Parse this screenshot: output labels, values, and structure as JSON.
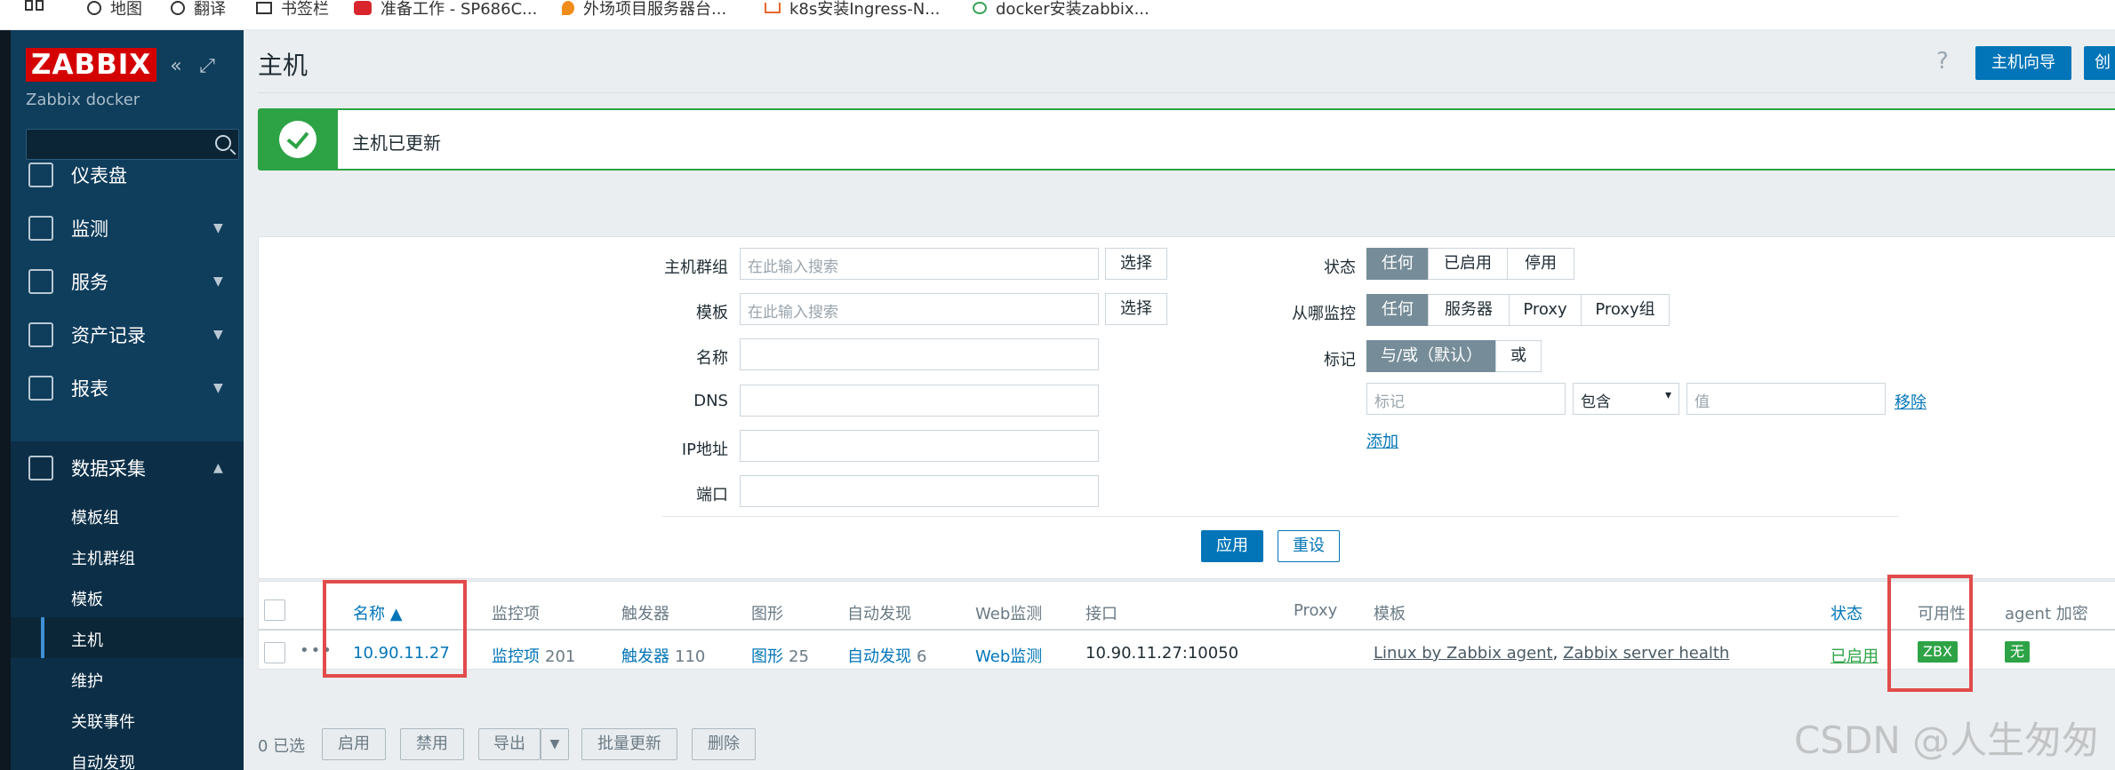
{
  "bookmarks": [
    "地图",
    "翻译",
    "书签栏",
    "准备工作 - SP686C...",
    "外场项目服务器台...",
    "k8s安装Ingress-N...",
    "docker安装zabbix..."
  ],
  "sidebar": {
    "logo": "ZABBIX",
    "subtitle": "Zabbix docker",
    "search_placeholder": "",
    "items": [
      {
        "label": "仪表盘",
        "icon": "dashboard-icon"
      },
      {
        "label": "监测",
        "icon": "monitoring-icon"
      },
      {
        "label": "服务",
        "icon": "services-icon"
      },
      {
        "label": "资产记录",
        "icon": "inventory-icon"
      },
      {
        "label": "报表",
        "icon": "reports-icon"
      },
      {
        "label": "数据采集",
        "icon": "data-collection-icon"
      }
    ],
    "subitems": [
      "模板组",
      "主机群组",
      "模板",
      "主机",
      "维护",
      "关联事件",
      "自动发现"
    ]
  },
  "header": {
    "title": "主机",
    "help": "?",
    "create_wizard": "主机向导",
    "create_host": "创"
  },
  "message": {
    "text": "主机已更新",
    "color": "#2da346"
  },
  "filter": {
    "host_groups_label": "主机群组",
    "host_groups_placeholder": "在此输入搜索",
    "templates_label": "模板",
    "templates_placeholder": "在此输入搜索",
    "select": "选择",
    "name_label": "名称",
    "dns_label": "DNS",
    "ip_label": "IP地址",
    "port_label": "端口",
    "status_label": "状态",
    "status_options": [
      "任何",
      "已启用",
      "停用"
    ],
    "monitored_by_label": "从哪监控",
    "monitored_by_options": [
      "任何",
      "服务器",
      "Proxy",
      "Proxy组"
    ],
    "tags_label": "标记",
    "tags_options": [
      "与/或（默认）",
      "或"
    ],
    "tag_placeholder": "标记",
    "tag_operator": "包含",
    "tag_value_placeholder": "值",
    "remove": "移除",
    "add": "添加",
    "apply": "应用",
    "reset": "重设"
  },
  "table": {
    "columns": [
      "名称 ▲",
      "监控项",
      "触发器",
      "图形",
      "自动发现",
      "Web监测",
      "接口",
      "Proxy",
      "模板",
      "状态",
      "可用性",
      "agent 加密"
    ],
    "rows": [
      {
        "name": "10.90.11.27",
        "items": "监控项",
        "items_count": "201",
        "triggers": "触发器",
        "triggers_count": "110",
        "graphs": "图形",
        "graphs_count": "25",
        "discovery": "自动发现",
        "discovery_count": "6",
        "web": "Web监测",
        "interface": "10.90.11.27:10050",
        "proxy": "",
        "template1": "Linux by Zabbix agent",
        "template_sep": ", ",
        "template2": "Zabbix server health",
        "status": "已启用",
        "availability": "ZBX",
        "encryption": "无"
      }
    ]
  },
  "bottom": {
    "selected": "0 已选",
    "enable": "启用",
    "disable": "禁用",
    "export": "导出",
    "mass_update": "批量更新",
    "delete": "删除"
  },
  "watermark": "CSDN @人生匆匆"
}
